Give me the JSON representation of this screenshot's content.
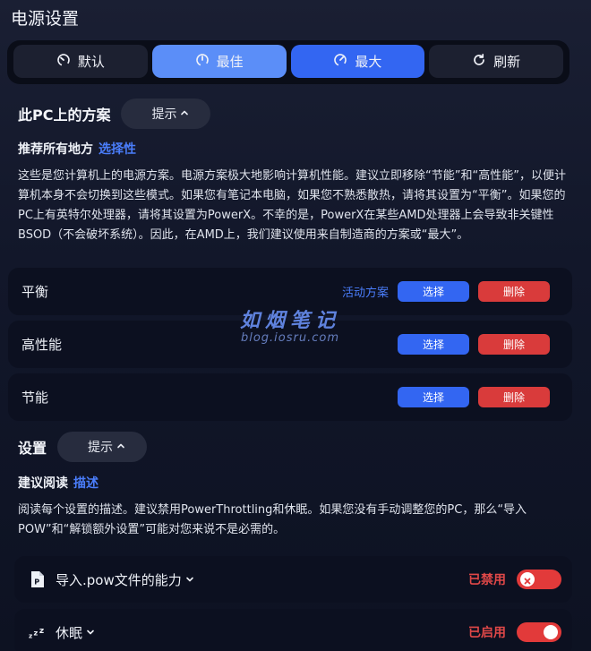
{
  "page_title": "电源设置",
  "modes": [
    {
      "label": "默认",
      "icon": "gauge-low-icon",
      "style": "dark"
    },
    {
      "label": "最佳",
      "icon": "gauge-mid-icon",
      "style": "light"
    },
    {
      "label": "最大",
      "icon": "gauge-high-icon",
      "style": "blue"
    },
    {
      "label": "刷新",
      "icon": "refresh-icon",
      "style": "dark"
    }
  ],
  "plans_section": {
    "title": "此PC上的方案",
    "hint_label": "提示",
    "sub_heading": "推荐所有地方",
    "sub_accent": "选择性",
    "description": "这些是您计算机上的电源方案。电源方案极大地影响计算机性能。建议立即移除“节能”和“高性能”，以便计算机本身不会切换到这些模式。如果您有笔记本电脑，如果您不熟悉散热，请将其设置为“平衡”。如果您的PC上有英特尔处理器，请将其设置为PowerX。不幸的是，PowerX在某些AMD处理器上会导致非关键性BSOD（不会破坏系统）。因此，在AMD上，我们建议使用来自制造商的方案或“最大”。",
    "plans": [
      {
        "name": "平衡",
        "active_label": "活动方案",
        "select_label": "选择",
        "delete_label": "删除"
      },
      {
        "name": "高性能",
        "active_label": "",
        "select_label": "选择",
        "delete_label": "删除"
      },
      {
        "name": "节能",
        "active_label": "",
        "select_label": "选择",
        "delete_label": "删除"
      }
    ]
  },
  "settings_section": {
    "title": "设置",
    "hint_label": "提示",
    "sub_heading": "建议阅读",
    "sub_accent": "描述",
    "description": "阅读每个设置的描述。建议禁用PowerThrottling和休眠。如果您没有手动调整您的PC，那么“导入POW”和“解锁额外设置”可能对您来说不是必需的。",
    "items": [
      {
        "label": "导入.pow文件的能力",
        "icon": "pow-file-icon",
        "state_label": "已禁用",
        "enabled": false
      },
      {
        "label": "休眠",
        "icon": "sleep-zzz-icon",
        "state_label": "已启用",
        "enabled": true
      }
    ]
  },
  "watermark": {
    "title": "如烟笔记",
    "subtitle": "blog.iosru.com"
  },
  "colors": {
    "accent": "#4a7dfa",
    "primary_blue": "#3366f2",
    "light_blue": "#5b8ef8",
    "danger": "#d93b3b"
  }
}
